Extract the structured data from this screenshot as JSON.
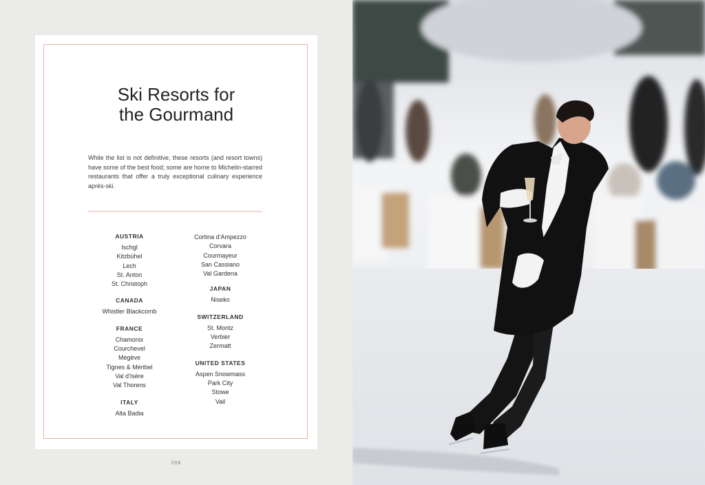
{
  "title_lines": [
    "Ski Resorts for",
    "the Gourmand"
  ],
  "intro": "While the list is not definitive, these resorts (and resort towns) have some of the best food; some are home to Michelin-starred restaurants that offer a truly exceptional culinary experience après-ski.",
  "columns": [
    {
      "groups": [
        {
          "country": "AUSTRIA",
          "towns": [
            "Ischgl",
            "Kitzbühel",
            "Lech",
            "St. Anton",
            "St. Christoph"
          ]
        },
        {
          "country": "CANADA",
          "towns": [
            "Whistler Blackcomb"
          ]
        },
        {
          "country": "FRANCE",
          "towns": [
            "Chamonix",
            "Courchevel",
            "Megève",
            "Tignes & Méribel",
            "Val d'Isère",
            "Val Thorens"
          ]
        },
        {
          "country": "ITALY",
          "towns": [
            "Alta Badia"
          ]
        }
      ]
    },
    {
      "groups": [
        {
          "country": "",
          "towns": [
            "Cortina d'Ampezzo",
            "Corvara",
            "Courmayeur",
            "San Cassiano",
            "Val Gardena"
          ]
        },
        {
          "country": "JAPAN",
          "towns": [
            "Niseko"
          ]
        },
        {
          "country": "SWITZERLAND",
          "towns": [
            "St. Moritz",
            "Verbier",
            "Zermatt"
          ]
        },
        {
          "country": "UNITED STATES",
          "towns": [
            "Aspen Snowmass",
            "Park City",
            "Stowe",
            "Vail"
          ]
        }
      ]
    }
  ],
  "page_number": "208"
}
